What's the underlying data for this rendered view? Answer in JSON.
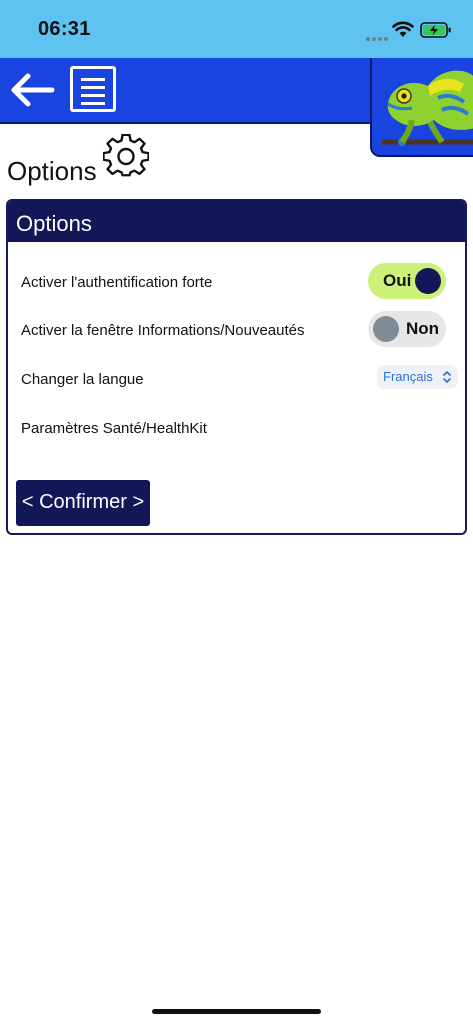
{
  "status_bar": {
    "time": "06:31"
  },
  "page": {
    "title": "Options"
  },
  "card": {
    "title": "Options",
    "rows": {
      "strong_auth": {
        "label": "Activer l'authentification forte",
        "toggle_text": "Oui",
        "state": "on"
      },
      "news_window": {
        "label": "Activer la fenêtre Informations/Nouveautés",
        "toggle_text": "Non",
        "state": "off"
      },
      "language": {
        "label": "Changer la langue",
        "selected": "Français"
      },
      "health": {
        "label": "Paramètres Santé/HealthKit"
      }
    },
    "confirm_label": "< Confirmer >"
  },
  "colors": {
    "status_bar": "#5ec3f1",
    "header": "#1a44df",
    "navy": "#131657",
    "toggle_on": "#cdf07a",
    "toggle_off": "#e6e6e6",
    "link_blue": "#2a6fe0"
  },
  "icons": {
    "back": "arrow-left-icon",
    "menu": "menu-lines-icon",
    "settings": "gear-icon",
    "logo": "chameleon-logo"
  }
}
